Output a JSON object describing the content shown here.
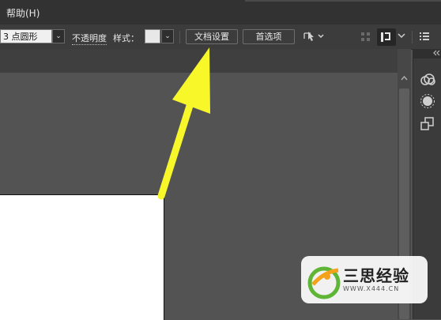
{
  "menubar": {
    "help": "帮助(H)"
  },
  "controlbar": {
    "stroke_value": "3 点圆形",
    "opacity_label": "不透明度",
    "style_label": "样式：",
    "document_setup": "文档设置",
    "preferences": "首选项"
  },
  "panel": {
    "icons": [
      "creative-cloud-icon",
      "appearance-icon",
      "transform-icon"
    ]
  },
  "watermark": {
    "title": "三思经验",
    "url": "WWW.X444.CN"
  },
  "colors": {
    "arrow": "#f7f72a",
    "canvas": "#535353",
    "toolbar": "#3c3c3c",
    "menubar": "#323232"
  }
}
